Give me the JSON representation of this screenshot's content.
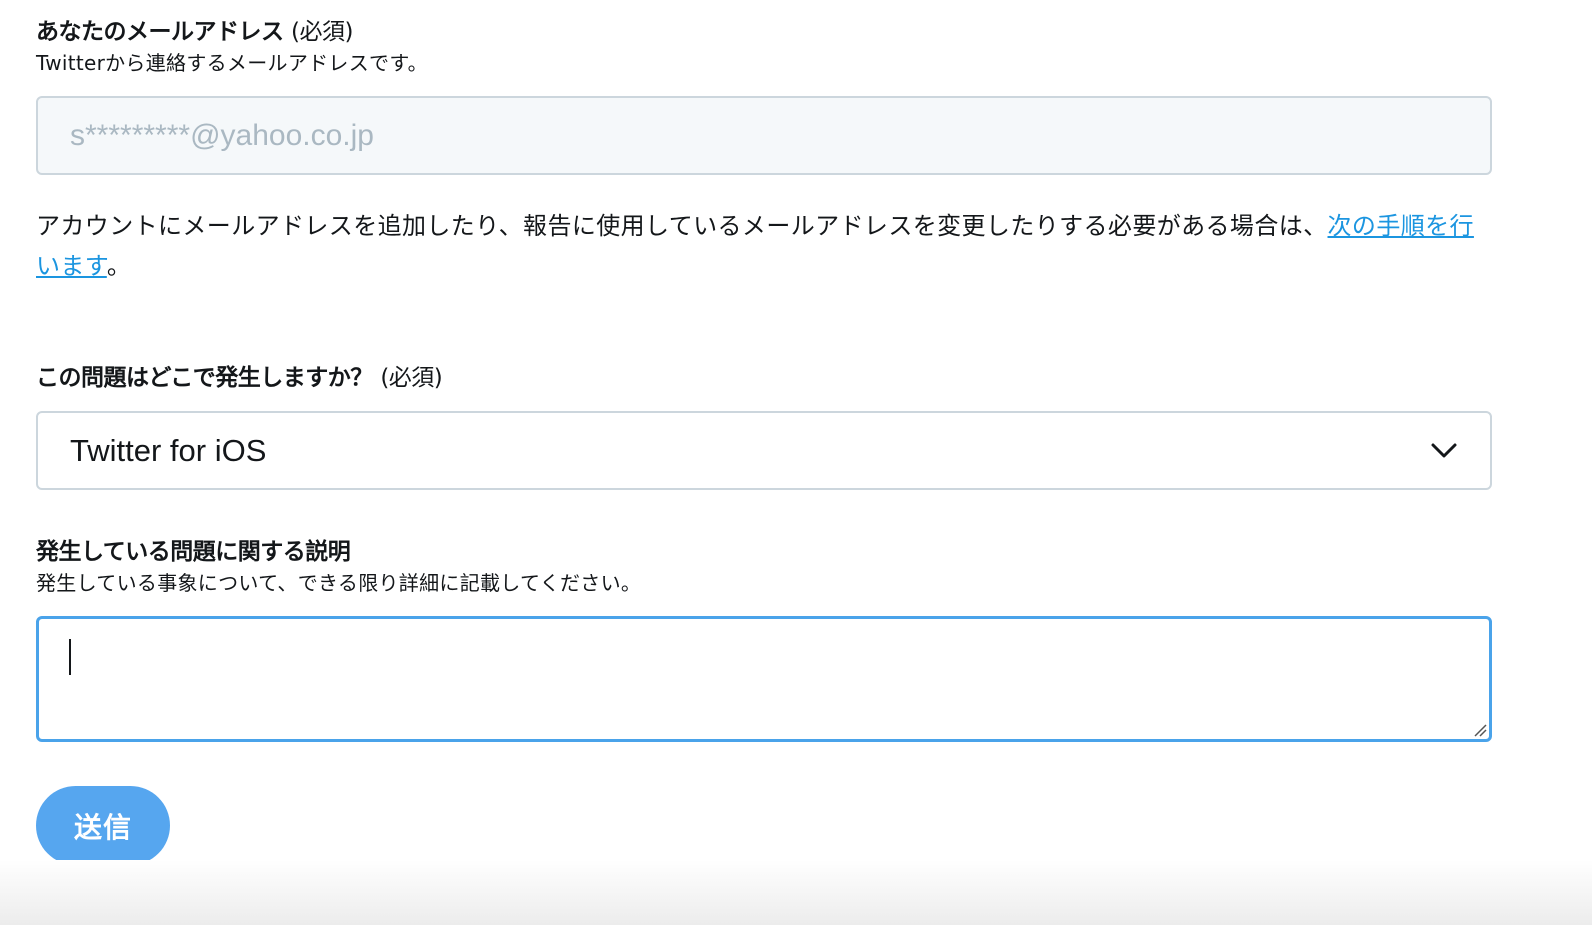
{
  "email_section": {
    "title": "あなたのメールアドレス",
    "required": "(必須)",
    "subtitle": "Twitterから連絡するメールアドレスです。",
    "value": "s*********@yahoo.co.jp"
  },
  "notice": {
    "text": "アカウントにメールアドレスを追加したり、報告に使用しているメールアドレスを変更したりする必要がある場合は、",
    "link": "次の手順を行います",
    "suffix": "。"
  },
  "location_section": {
    "title": "この問題はどこで発生しますか？",
    "required": "(必須)",
    "selected": "Twitter for iOS"
  },
  "description_section": {
    "title": "発生している問題に関する説明",
    "subtitle": "発生している事象について、できる限り詳細に記載してください。",
    "value": ""
  },
  "submit": {
    "label": "送信"
  },
  "colors": {
    "accent": "#1b95e0",
    "button": "#56a6ef",
    "focus_border": "#4aa3ea"
  }
}
